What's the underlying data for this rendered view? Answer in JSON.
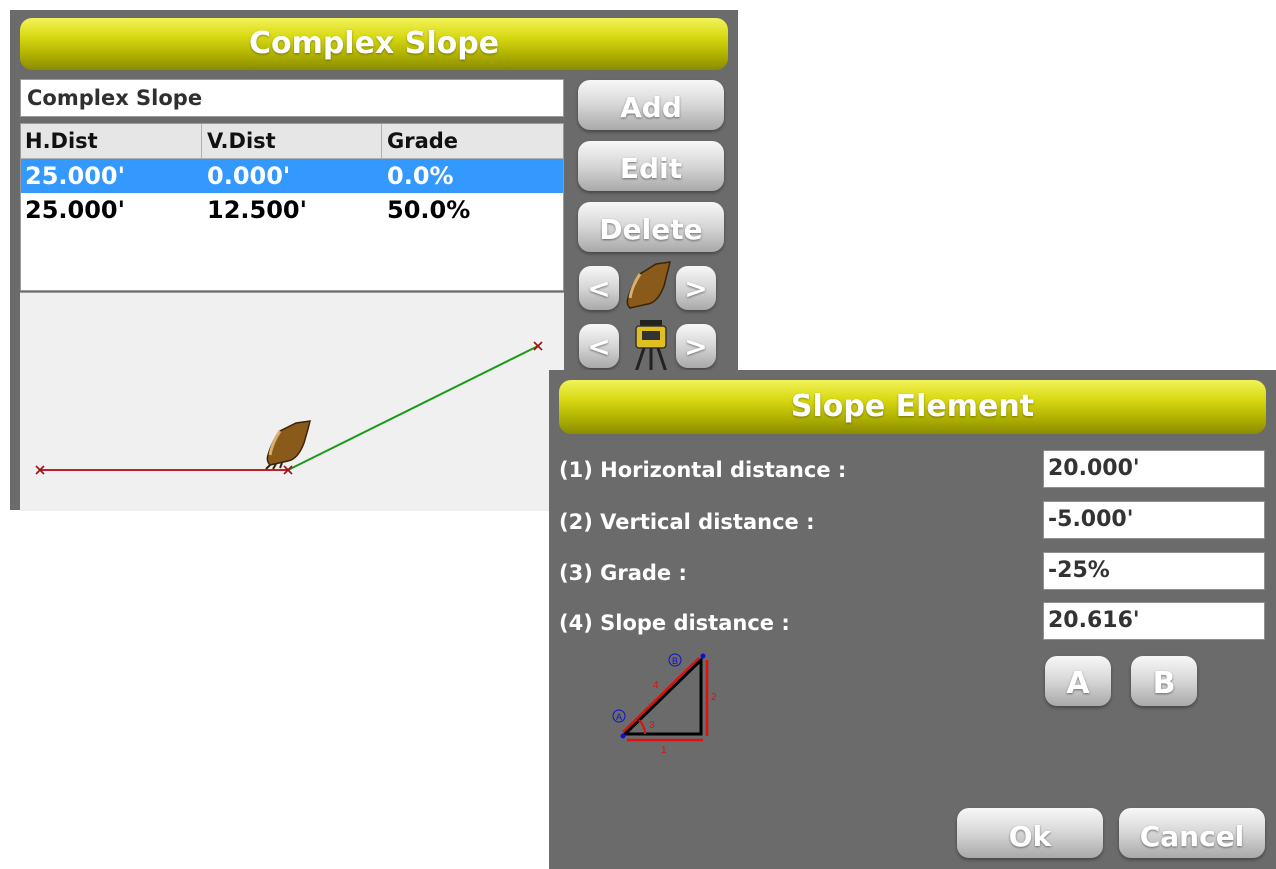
{
  "complex_slope": {
    "title": "Complex Slope",
    "name_value": "Complex Slope",
    "table": {
      "headers": [
        "H.Dist",
        "V.Dist",
        "Grade"
      ],
      "rows": [
        {
          "h_dist": "25.000'",
          "v_dist": "0.000'",
          "grade": "0.0%",
          "selected": true
        },
        {
          "h_dist": "25.000'",
          "v_dist": "12.500'",
          "grade": "50.0%",
          "selected": false
        }
      ]
    },
    "buttons": {
      "add": "Add",
      "edit": "Edit",
      "delete": "Delete",
      "prev": "<",
      "next": ">"
    },
    "icons": {
      "bucket": "excavator-bucket-icon",
      "instrument": "total-station-icon"
    },
    "profile_colors": {
      "first_segment": "#c0202a",
      "second_segment": "#1a9a1a"
    }
  },
  "slope_element": {
    "title": "Slope Element",
    "fields": [
      {
        "label": "(1) Horizontal distance :",
        "value": "20.000'"
      },
      {
        "label": "(2) Vertical distance :",
        "value": "-5.000'"
      },
      {
        "label": "(3) Grade :",
        "value": "-25%"
      },
      {
        "label": "(4) Slope distance :",
        "value": "20.616'"
      }
    ],
    "diagram_labels": {
      "side_1": "1",
      "side_2": "2",
      "angle_3": "3",
      "side_4": "4",
      "point_a": "A",
      "point_b": "B"
    },
    "buttons": {
      "a": "A",
      "b": "B",
      "ok": "Ok",
      "cancel": "Cancel"
    }
  },
  "colors": {
    "title_bar": "#d4d51a",
    "panel_bg": "#6b6b6b",
    "selection": "#3399ff"
  }
}
